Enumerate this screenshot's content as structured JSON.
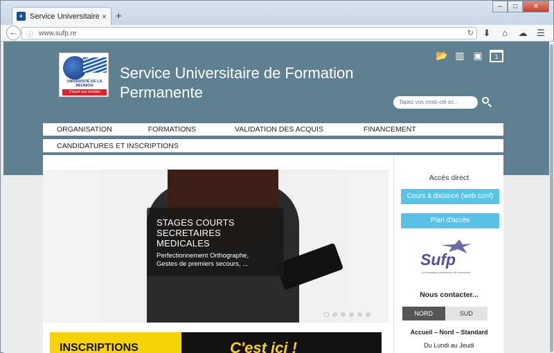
{
  "browser": {
    "tab_title": "Service Universitaire de For...",
    "tab_close": "×",
    "new_tab": "+",
    "url": "www.sufp.re",
    "window_controls": [
      "–",
      "□",
      "✕"
    ]
  },
  "site": {
    "logo_univ": "UNIVERSITÉ DE LA RÉUNION",
    "logo_tagline": "S'ouvrir aux mondes",
    "title_line1": "Service Universitaire de Formation",
    "title_line2": "Permanente",
    "calendar_day": "1",
    "search_placeholder": "Tapez vos mots-clé ici..."
  },
  "menu": {
    "row1": [
      "ORGANISATION",
      "FORMATIONS",
      "VALIDATION DES ACQUIS",
      "FINANCEMENT"
    ],
    "row2": [
      "CANDIDATURES ET INSCRIPTIONS"
    ]
  },
  "slider": {
    "caption_title_line1": "STAGES COURTS",
    "caption_title_line2": "SECRETAIRES MEDICALES",
    "caption_sub_line1": "Perfectionnement Orthographe,",
    "caption_sub_line2": "Gestes de premiers secours, ...",
    "dot_count": 6,
    "active_dot": 0
  },
  "banner": {
    "left_text": "INSCRIPTIONS",
    "right_text": "C'est ici !"
  },
  "sidebar": {
    "title": "Accès direct",
    "btn1": "Cours à distance (web conf)",
    "btn2": "Plan d'accès",
    "logo_word": "Sufp",
    "logo_tagline": "La formation permanente de l'université",
    "contact_title": "Nous contacter...",
    "tab_nord": "NORD",
    "tab_sud": "SUD",
    "contact_line1": "Accueil – Nord – Standard",
    "contact_line2": "Du Lundi au Jeudi"
  },
  "colors": {
    "header_band": "#5e8090",
    "accent_button": "#5bc2e6",
    "banner_yellow": "#f7d30a"
  }
}
